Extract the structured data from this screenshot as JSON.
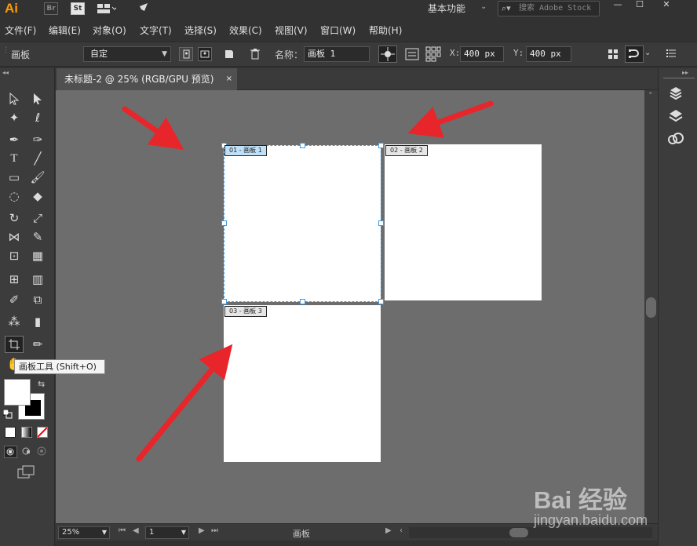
{
  "app": {
    "logo": "Ai",
    "bridge_label": "Br",
    "stock_label": "St",
    "workspace": "基本功能",
    "stock_search_placeholder": "搜索 Adobe Stock",
    "window_controls": [
      "minimize",
      "maximize",
      "close"
    ]
  },
  "menu": [
    "文件(F)",
    "编辑(E)",
    "对象(O)",
    "文字(T)",
    "选择(S)",
    "效果(C)",
    "视图(V)",
    "窗口(W)",
    "帮助(H)"
  ],
  "control_bar": {
    "panel_label": "画板",
    "preset_value": "自定",
    "name_label": "名称：",
    "name_value": "画板 1",
    "x_label": "X:",
    "x_value": "400 px",
    "y_label": "Y:",
    "y_value": "400 px"
  },
  "document_tab": {
    "title": "未标题-2 @ 25% (RGB/GPU 预览)",
    "close": "×"
  },
  "tooltip": "画板工具 (Shift+O)",
  "artboards": [
    {
      "label": "01 - 画板 1",
      "selected": true
    },
    {
      "label": "02 - 画板 2",
      "selected": false
    },
    {
      "label": "03 - 画板 3",
      "selected": false
    }
  ],
  "status_bar": {
    "zoom": "25%",
    "artboard_number": "1",
    "status_text": "画板"
  },
  "colors": {
    "accent_selection": "#3d9be9",
    "annotation_arrow": "#e8252a",
    "canvas": "#6d6d6d"
  },
  "watermark": {
    "logo": "Bai 经验",
    "url": "jingyan.baidu.com"
  }
}
